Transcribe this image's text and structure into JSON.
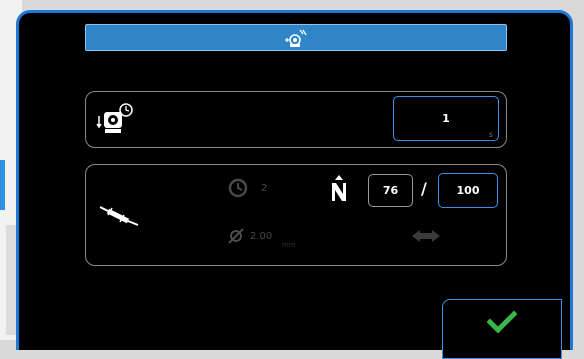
{
  "dialog": {
    "title_icon": "pump-manual-icon",
    "accent_color": "#1e78d8",
    "title_bar_color": "#2f85c8"
  },
  "delay_panel": {
    "icon": "pump-timer-icon",
    "value": "1",
    "unit": "s"
  },
  "pump_panel": {
    "icon": "syringe-icon",
    "time_icon": "clock-icon",
    "time_value": "2",
    "diameter_icon": "diameter-icon",
    "diameter_value": "2.00",
    "diameter_unit": "mm",
    "speed_icon": "rpm-n-icon",
    "speed_value": "76",
    "separator": "/",
    "speed_max": "100",
    "direction_icon": "reverse-direction-icon"
  },
  "confirm": {
    "icon": "checkmark-icon",
    "color": "#39b54a"
  }
}
